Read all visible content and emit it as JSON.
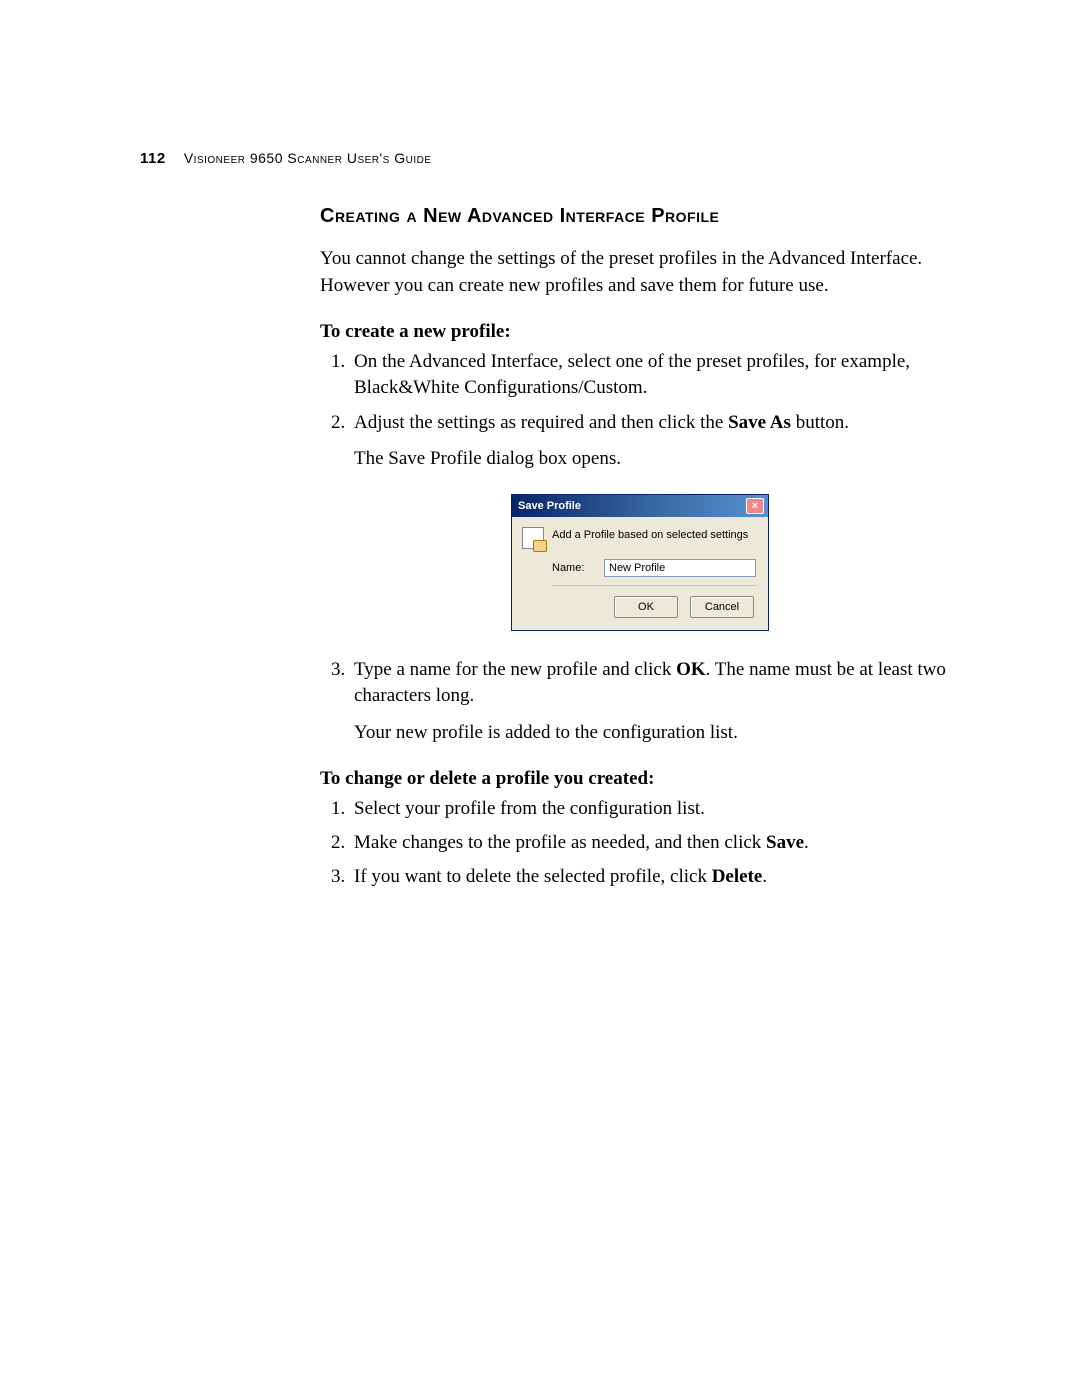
{
  "header": {
    "page_number": "112",
    "running_title": "Visioneer 9650 Scanner User's Guide"
  },
  "section_title": "Creating a New Advanced Interface Profile",
  "intro": "You cannot change the settings of the preset profiles in the Advanced Interface. However you can create new profiles and save them for future use.",
  "create": {
    "subhead": "To create a new profile:",
    "steps": {
      "s1": "On the Advanced Interface, select one of the preset profiles, for example, Black&White Configurations/Custom.",
      "s2_a": "Adjust the settings as required and then click the ",
      "s2_bold": "Save As",
      "s2_b": " button.",
      "s2_follow": "The Save Profile dialog box opens.",
      "s3_a": "Type a name for the new profile and click ",
      "s3_bold": "OK",
      "s3_b": ". The name must be at least two characters long.",
      "s3_follow": "Your new profile is added to the configuration list."
    }
  },
  "change": {
    "subhead": "To change or delete a profile you created:",
    "steps": {
      "s1": "Select your profile from the configuration list.",
      "s2_a": "Make changes to the profile as needed, and then click ",
      "s2_bold": "Save",
      "s2_b": ".",
      "s3_a": "If you want to delete the selected profile, click ",
      "s3_bold": "Delete",
      "s3_b": "."
    }
  },
  "dialog": {
    "title": "Save Profile",
    "message": "Add a Profile based on selected settings",
    "name_label": "Name:",
    "name_value": "New Profile",
    "ok": "OK",
    "cancel": "Cancel"
  }
}
